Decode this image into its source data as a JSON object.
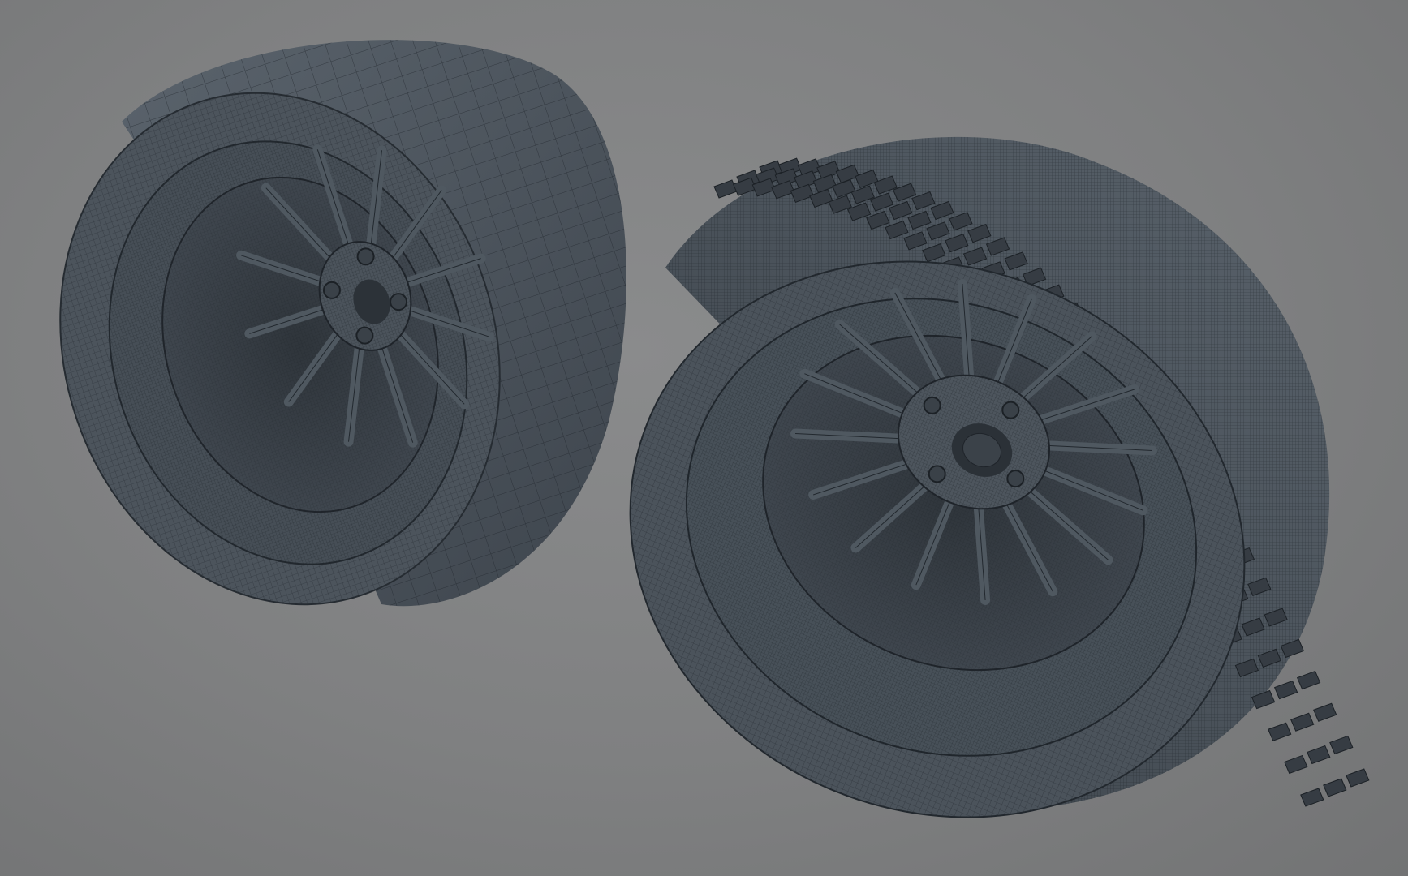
{
  "scene": {
    "background_color": "#7f8081",
    "mesh_color": "#4a525a",
    "wire_color": "#20262c",
    "objects": [
      {
        "name": "slick-tire-wheel",
        "tread": "slick",
        "spoke_count": 12,
        "lug_count": 4
      },
      {
        "name": "treaded-tire-wheel",
        "tread": "patterned",
        "spoke_count": 16,
        "lug_count": 4
      }
    ]
  }
}
